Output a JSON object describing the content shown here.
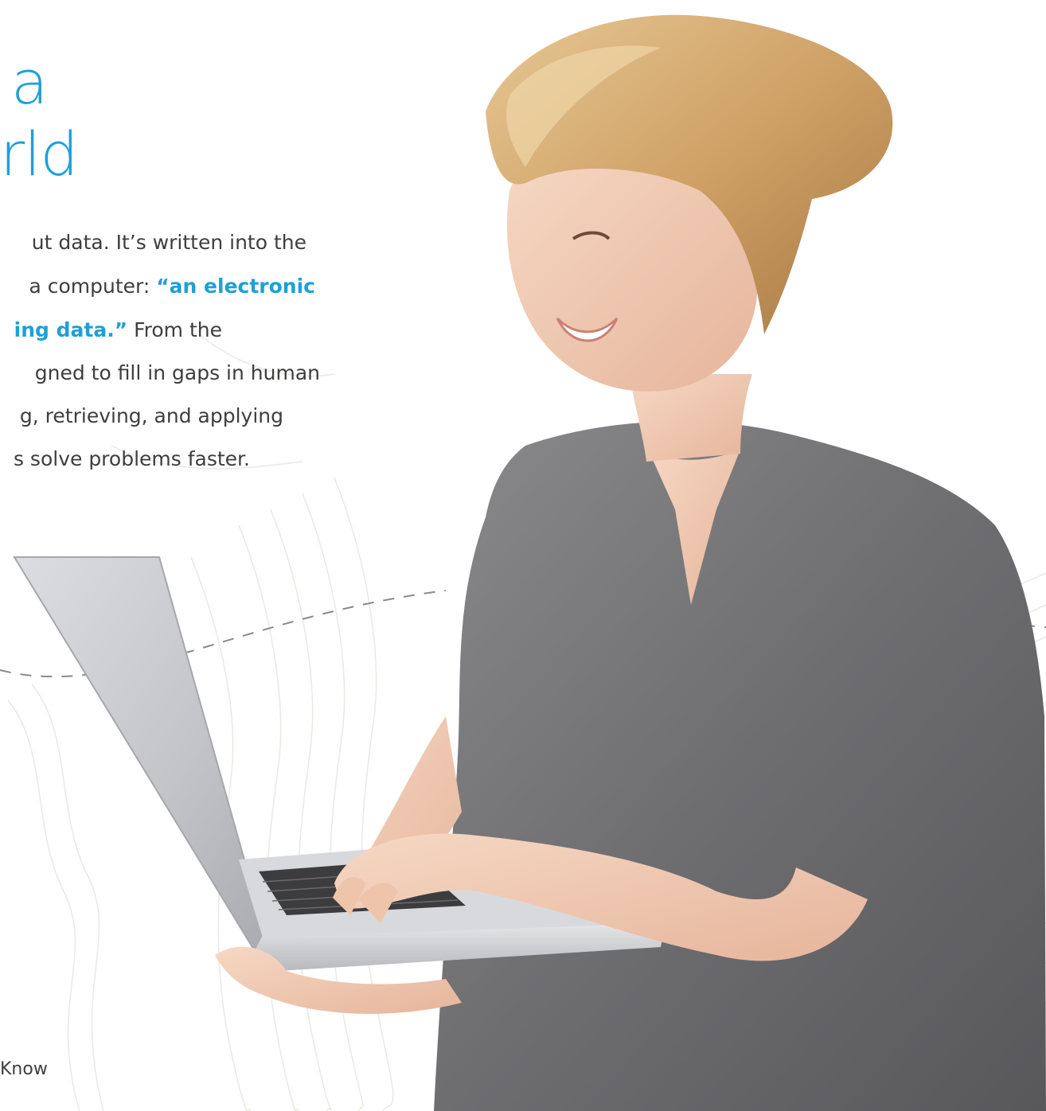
{
  "headline": {
    "line1": "a",
    "line2": "rld"
  },
  "body": {
    "line1_text": "ut data. It’s written into the",
    "line2_text": "a computer: ",
    "line2_highlight": "“an electronic",
    "line3_highlight": "ing data.”",
    "line3_text": " From the",
    "line4_text": "gned to fill in gaps in human",
    "line5_text": "g, retrieving, and applying",
    "line6_text": "s solve problems faster."
  },
  "footer": {
    "text": "Know"
  },
  "colors": {
    "accent": "#1ea0d7",
    "body_text": "#3e3e3e",
    "topo_lines": "#ece8e2",
    "dashed": "#8a8a8a"
  }
}
